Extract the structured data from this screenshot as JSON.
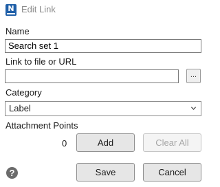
{
  "window": {
    "title": "Edit Link",
    "app_icon_letter": "N"
  },
  "form": {
    "name_label": "Name",
    "name_value": "Search set 1",
    "link_label": "Link to file or URL",
    "link_value": "",
    "browse_label": "...",
    "category_label": "Category",
    "category_selected": "Label",
    "attachment_label": "Attachment Points",
    "attachment_count": "0",
    "add_label": "Add",
    "clear_all_label": "Clear All"
  },
  "footer": {
    "help_glyph": "?",
    "save_label": "Save",
    "cancel_label": "Cancel"
  },
  "colors": {
    "app_icon": "#1f5fa8",
    "button_face": "#e6e6e6",
    "disabled_text": "#a6a6a6"
  }
}
